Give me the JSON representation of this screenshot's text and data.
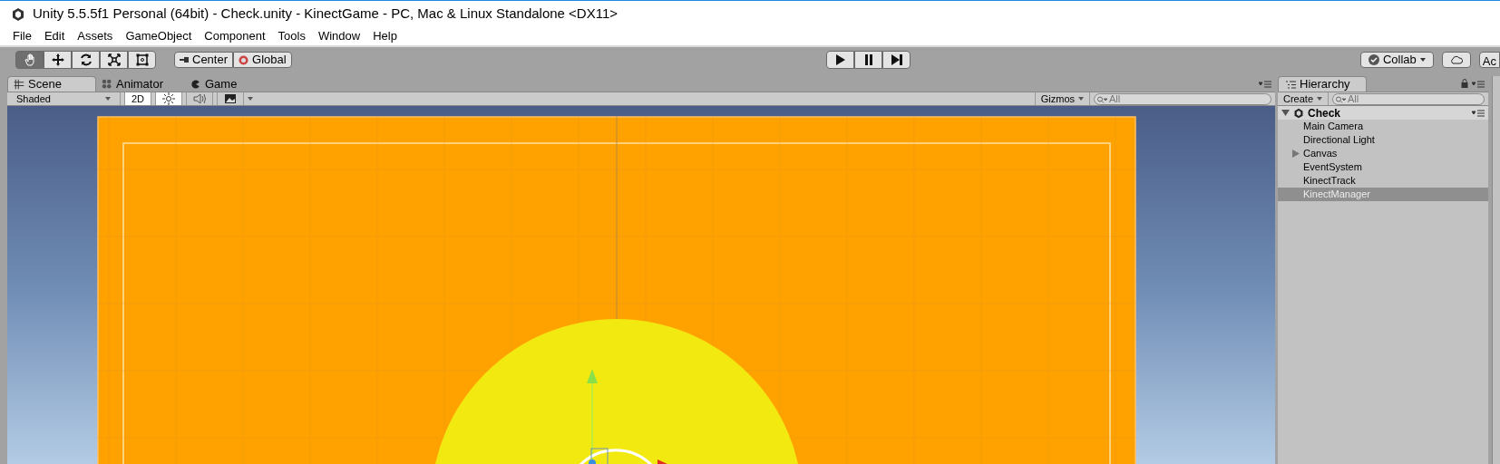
{
  "window": {
    "title": "Unity 5.5.5f1 Personal (64bit) - Check.unity - KinectGame - PC, Mac & Linux Standalone <DX11>"
  },
  "menu": [
    "File",
    "Edit",
    "Assets",
    "GameObject",
    "Component",
    "Tools",
    "Window",
    "Help"
  ],
  "toolbar": {
    "tools": [
      {
        "kind": "hand",
        "selected": true
      },
      {
        "kind": "move",
        "selected": false
      },
      {
        "kind": "rotate",
        "selected": false
      },
      {
        "kind": "scale",
        "selected": false
      },
      {
        "kind": "rect",
        "selected": false
      }
    ],
    "pivot": [
      {
        "kind": "center",
        "label": "Center"
      },
      {
        "kind": "global",
        "label": "Global"
      }
    ],
    "collab": "Collab",
    "account": "Ac"
  },
  "scene_tabs": [
    {
      "label": "Scene",
      "kind": "scene",
      "selected": true
    },
    {
      "label": "Animator",
      "kind": "animator",
      "selected": false
    },
    {
      "label": "Game",
      "kind": "game",
      "selected": false
    }
  ],
  "scene_toolbar": {
    "draw_mode": "Shaded",
    "toggles": [
      {
        "kind": "dimension",
        "label": "2D",
        "on": true
      },
      {
        "kind": "light",
        "on": true
      },
      {
        "kind": "audio",
        "on": false
      },
      {
        "kind": "effects",
        "on": false
      }
    ],
    "gizmos": "Gizmos",
    "search": {
      "placeholder": "All"
    }
  },
  "hierarchy": {
    "tab": "Hierarchy",
    "create": "Create",
    "search": {
      "placeholder": "All"
    },
    "scene": {
      "name": "Check",
      "expanded": true
    },
    "items": [
      {
        "name": "Main Camera",
        "selected": false
      },
      {
        "name": "Directional Light",
        "selected": false
      },
      {
        "name": "Canvas",
        "selected": false,
        "expanded": false
      },
      {
        "name": "EventSystem",
        "selected": false
      },
      {
        "name": "KinectTrack",
        "selected": false
      },
      {
        "name": "KinectManager",
        "selected": true
      }
    ]
  }
}
